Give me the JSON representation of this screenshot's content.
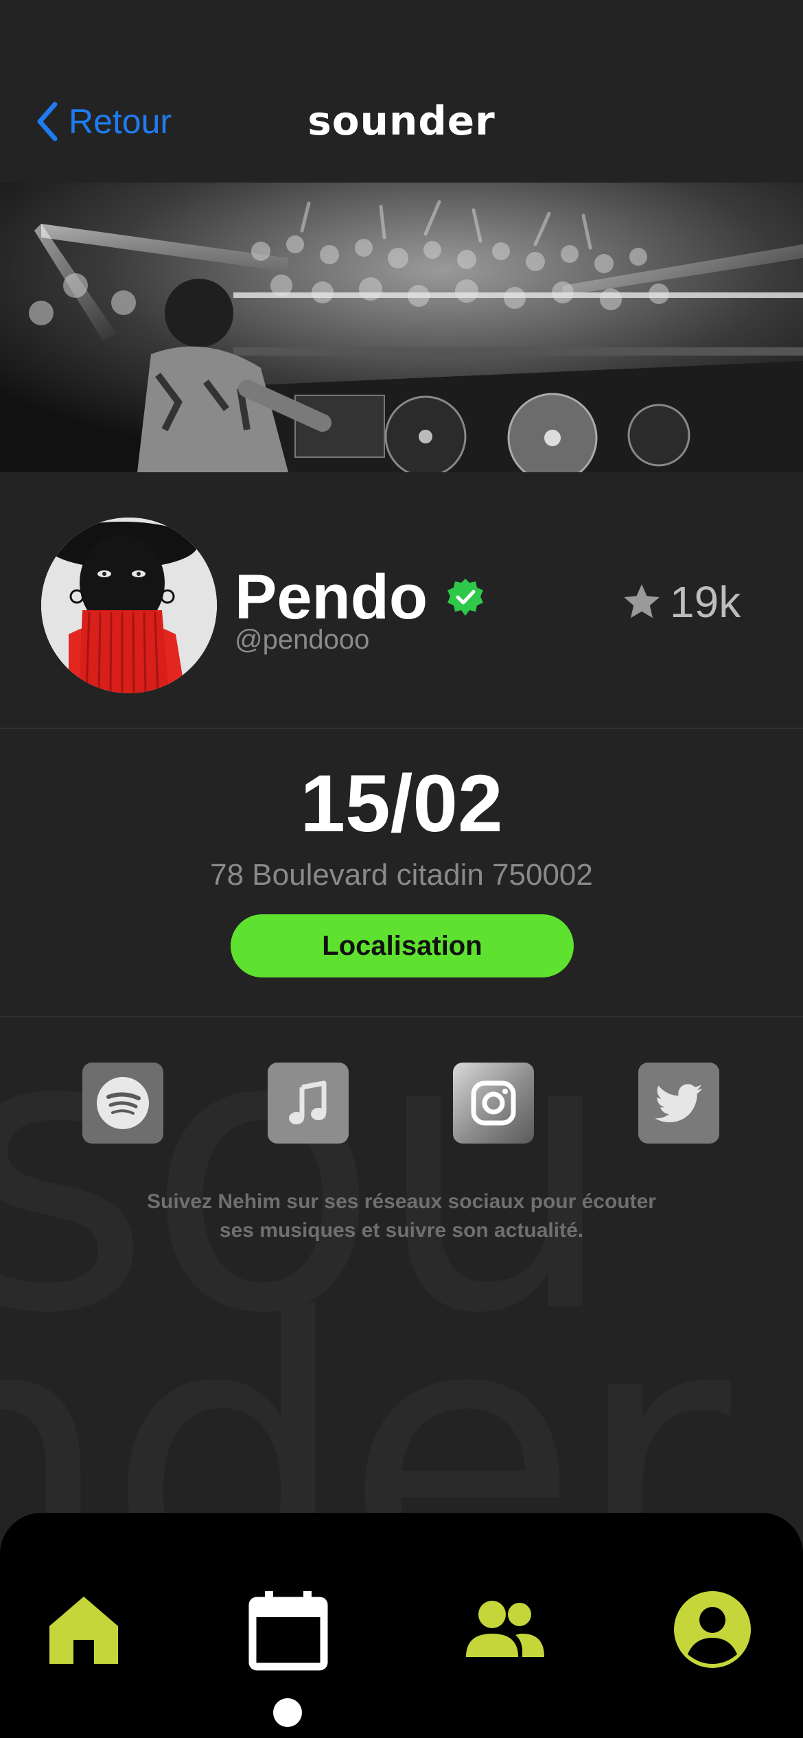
{
  "header": {
    "back_label": "Retour",
    "brand": "sounder",
    "back_color": "#1e7cf0"
  },
  "hero": {
    "image": "dj-crowd-photo"
  },
  "profile": {
    "name": "Pendo",
    "handle": "@pendooo",
    "verified_icon": "verified-badge-icon",
    "stars_icon": "star-icon",
    "stars_count": "19k"
  },
  "event": {
    "date": "15/02",
    "address": "78 Boulevard citadin 750002",
    "location_button": "Localisation",
    "button_color": "#5ee22f"
  },
  "socials": {
    "items": [
      {
        "name": "spotify",
        "icon": "spotify-icon"
      },
      {
        "name": "apple-music",
        "icon": "music-note-icon"
      },
      {
        "name": "instagram",
        "icon": "instagram-icon"
      },
      {
        "name": "twitter",
        "icon": "twitter-icon"
      }
    ],
    "text_line1": "Suivez Nehim sur ses réseaux sociaux  pour écouter",
    "text_line2": "ses musiques et suivre son actualité."
  },
  "watermark": {
    "line1": "sou",
    "line2": "nder"
  },
  "tabbar": {
    "accent": "#c5d63a",
    "active_tab": "calendar",
    "tabs": [
      {
        "name": "home",
        "icon": "home-icon"
      },
      {
        "name": "calendar",
        "icon": "calendar-icon"
      },
      {
        "name": "friends",
        "icon": "people-icon"
      },
      {
        "name": "profile",
        "icon": "account-circle-icon"
      }
    ]
  }
}
